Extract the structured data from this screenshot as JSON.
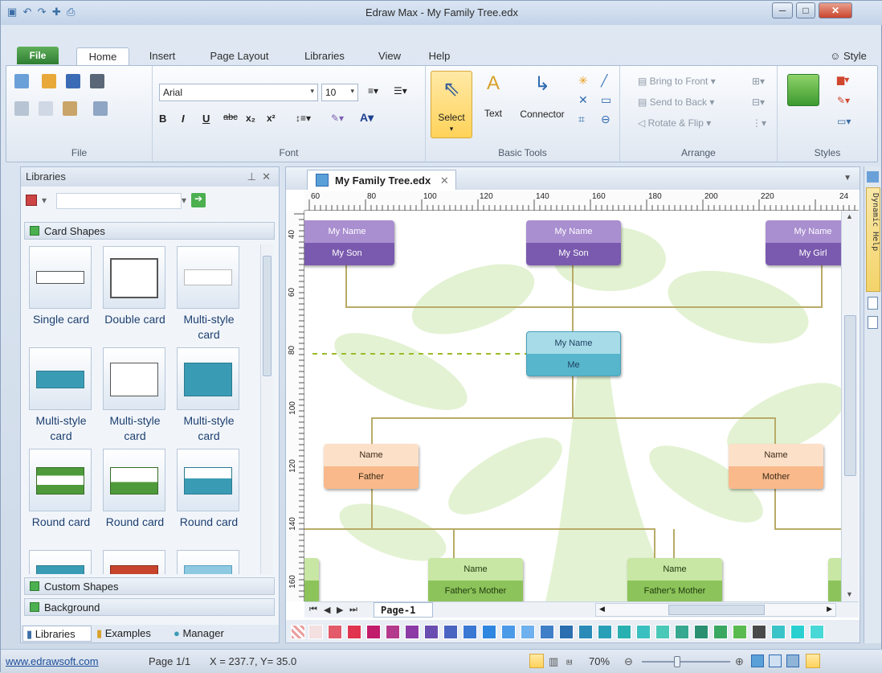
{
  "window": {
    "title": "Edraw Max - My Family Tree.edx"
  },
  "menu_tabs": [
    "File",
    "Home",
    "Insert",
    "Page Layout",
    "Libraries",
    "View",
    "Help"
  ],
  "style_label": "Style",
  "ribbon": {
    "groups": {
      "file": "File",
      "font": "Font",
      "basic_tools": "Basic Tools",
      "arrange": "Arrange",
      "styles": "Styles"
    },
    "font_name": "Arial",
    "font_size": "10",
    "format_buttons": [
      "B",
      "I",
      "U",
      "abc",
      "x₂",
      "x²"
    ],
    "tools": {
      "select": "Select",
      "text": "Text",
      "connector": "Connector"
    },
    "arrange": {
      "bring_front": "Bring to Front",
      "send_back": "Send to Back",
      "rotate_flip": "Rotate & Flip"
    }
  },
  "libraries": {
    "title": "Libraries",
    "categories": {
      "card_shapes": "Card Shapes",
      "custom_shapes": "Custom Shapes",
      "background": "Background"
    },
    "shapes": [
      {
        "label": "Single card"
      },
      {
        "label": "Double card"
      },
      {
        "label": "Multi-style card"
      },
      {
        "label": "Multi-style card"
      },
      {
        "label": "Multi-style card"
      },
      {
        "label": "Multi-style card"
      },
      {
        "label": "Round card"
      },
      {
        "label": "Round card"
      },
      {
        "label": "Round card"
      }
    ],
    "bottom_tabs": [
      "Libraries",
      "Examples",
      "Manager"
    ]
  },
  "document": {
    "tab_title": "My Family Tree.edx",
    "ruler_h": [
      "60",
      "80",
      "100",
      "120",
      "140",
      "160",
      "180",
      "200",
      "220",
      "24"
    ],
    "ruler_v": [
      "40",
      "60",
      "80",
      "100",
      "120",
      "140",
      "160"
    ],
    "page_tab": "Page-1",
    "cards": [
      {
        "top": "My Name",
        "bottom": "My Son"
      },
      {
        "top": "My Name",
        "bottom": "My Son"
      },
      {
        "top": "My Name",
        "bottom": "My Girl"
      },
      {
        "top": "My Name",
        "bottom": "Me"
      },
      {
        "top": "Name",
        "bottom": "Father"
      },
      {
        "top": "Name",
        "bottom": "Mother"
      },
      {
        "top": "Name",
        "bottom": "Father's Mother"
      },
      {
        "top": "Name",
        "bottom": "Father's Mother"
      }
    ]
  },
  "side_panel": {
    "dynamic_help": "Dynamic Help"
  },
  "status": {
    "website": "www.edrawsoft.com",
    "page": "Page 1/1",
    "coords": "X = 237.7, Y= 35.0",
    "zoom": "70%"
  },
  "palette_colors": [
    "#f4e0e0",
    "#e35a6a",
    "#e0344f",
    "#c21c6c",
    "#b43a8c",
    "#8c3aa6",
    "#6a4db0",
    "#4a64c2",
    "#3a78d4",
    "#2f86e0",
    "#4a9ae8",
    "#6fb1ee",
    "#3f7fc8",
    "#2b6fb0",
    "#2a8bb8",
    "#2aa0b8",
    "#2ab0b0",
    "#3ac0c0",
    "#4ac8b8",
    "#38a890",
    "#2a9070",
    "#3aa860",
    "#5abb50",
    "#4a4a4a",
    "#3ac4c8",
    "#2ad0d0",
    "#48d8d8"
  ]
}
